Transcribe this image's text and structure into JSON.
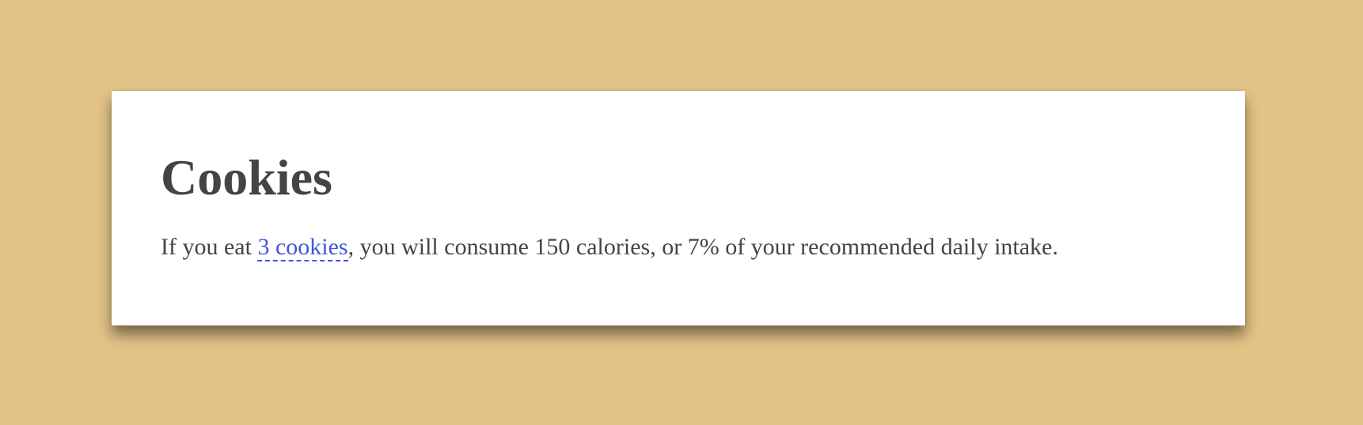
{
  "card": {
    "title": "Cookies",
    "sentence": {
      "prefix": "If you eat ",
      "cookie_count_label": "3 cookies",
      "middle": ", you will consume ",
      "calories_text": "150 calories",
      "joiner": ", or ",
      "percent_text": "7%",
      "suffix": " of your recommended daily intake."
    }
  },
  "colors": {
    "background": "#e2c387",
    "card": "#ffffff",
    "text": "#444444",
    "link": "#4157d9"
  }
}
